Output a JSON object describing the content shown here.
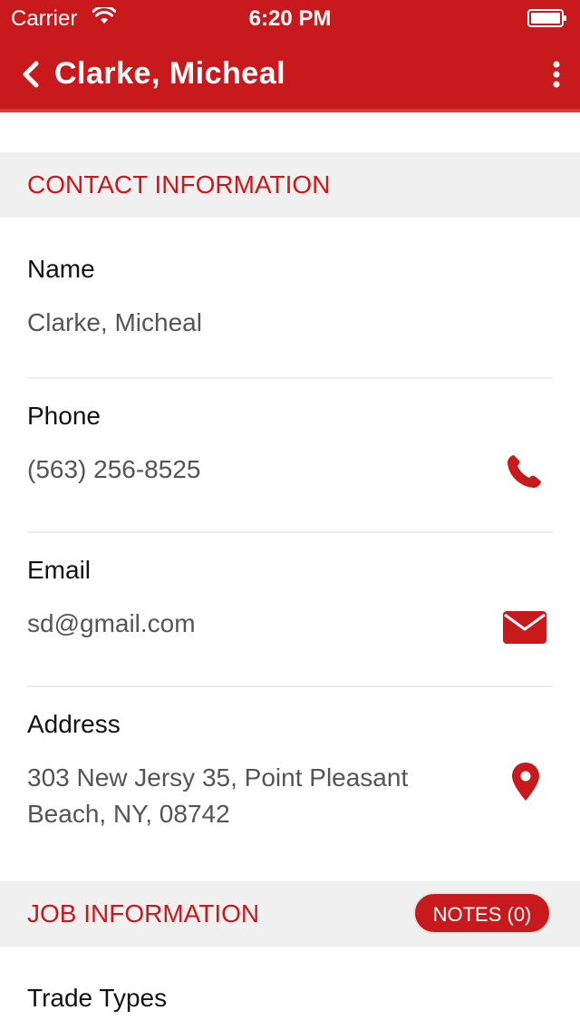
{
  "status_bar": {
    "carrier": "Carrier",
    "time": "6:20 PM"
  },
  "nav": {
    "title": "Clarke, Micheal"
  },
  "contact_section": {
    "title": "CONTACT INFORMATION",
    "name_label": "Name",
    "name_value": "Clarke, Micheal",
    "phone_label": "Phone",
    "phone_value": "(563) 256-8525",
    "email_label": "Email",
    "email_value": "sd@gmail.com",
    "address_label": "Address",
    "address_line1": "303 New Jersy 35, Point Pleasant",
    "address_line2": "Beach, NY, 08742"
  },
  "job_section": {
    "title": "JOB INFORMATION",
    "notes_button": "NOTES (0)",
    "trade_types_label": "Trade Types"
  },
  "colors": {
    "brand_red": "#c8191d",
    "section_bg": "#f0f0f0"
  },
  "icons": {
    "back": "chevron-left-icon",
    "more": "more-vertical-icon",
    "phone": "phone-icon",
    "email": "envelope-icon",
    "address": "map-pin-icon"
  }
}
